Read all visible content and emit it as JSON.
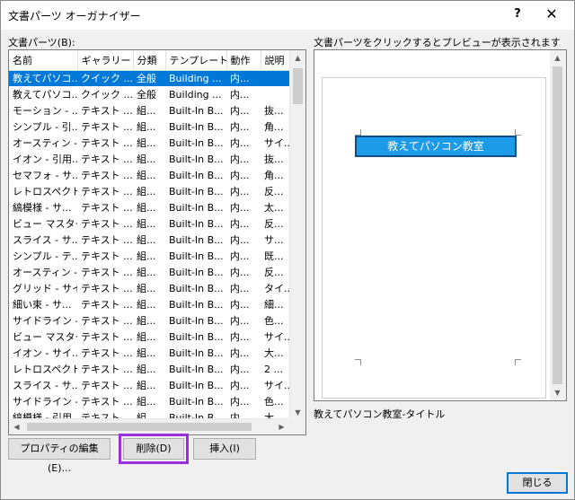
{
  "window": {
    "title": "文書パーツ オーガナイザー",
    "help_glyph": "?",
    "close_glyph": "✕"
  },
  "list": {
    "label": "文書パーツ(B):",
    "columns": [
      "名前",
      "ギャラリー",
      "分類",
      "テンプレート",
      "動作",
      "説明"
    ],
    "rows": [
      [
        "教えてパソコ...",
        "クイック ...",
        "全般",
        "Building ...",
        "内...",
        ""
      ],
      [
        "教えてパソコ...",
        "クイック ...",
        "全般",
        "Building ...",
        "内...",
        ""
      ],
      [
        "モーション - ...",
        "テキスト ...",
        "組...",
        "Built-In B...",
        "内...",
        "抜..."
      ],
      [
        "シンプル - 引...",
        "テキスト ...",
        "組...",
        "Built-In B...",
        "内...",
        "角..."
      ],
      [
        "オースティン - ...",
        "テキスト ...",
        "組...",
        "Built-In B...",
        "内...",
        "サイ..."
      ],
      [
        "イオン - 引用...",
        "テキスト ...",
        "組...",
        "Built-In B...",
        "内...",
        "抜..."
      ],
      [
        "セマフォ - サ...",
        "テキスト ...",
        "組...",
        "Built-In B...",
        "内...",
        "角..."
      ],
      [
        "レトロスペクト...",
        "テキスト ...",
        "組...",
        "Built-In B...",
        "内...",
        "反..."
      ],
      [
        "縞模様 - サ...",
        "テキスト ...",
        "組...",
        "Built-In B...",
        "内...",
        "太..."
      ],
      [
        "ビュー マスター...",
        "テキスト ...",
        "組...",
        "Built-In B...",
        "内...",
        "反..."
      ],
      [
        "スライス - サ...",
        "テキスト ...",
        "組...",
        "Built-In B...",
        "内...",
        "サ..."
      ],
      [
        "シンプル - テ...",
        "テキスト ...",
        "組...",
        "Built-In B...",
        "内...",
        "既..."
      ],
      [
        "オースティン - ...",
        "テキスト ...",
        "組...",
        "Built-In B...",
        "内...",
        "反..."
      ],
      [
        "グリッド - サイ...",
        "テキスト ...",
        "組...",
        "Built-In B...",
        "内...",
        "タイ..."
      ],
      [
        "細い束 - サ...",
        "テキスト ...",
        "組...",
        "Built-In B...",
        "内...",
        "細..."
      ],
      [
        "サイドライン - ...",
        "テキスト ...",
        "組...",
        "Built-In B...",
        "内...",
        "色..."
      ],
      [
        "ビュー マスター...",
        "テキスト ...",
        "組...",
        "Built-In B...",
        "内...",
        "サイ..."
      ],
      [
        "イオン - サイ...",
        "テキスト ...",
        "組...",
        "Built-In B...",
        "内...",
        "大..."
      ],
      [
        "レトロスペクト...",
        "テキスト ...",
        "組...",
        "Built-In B...",
        "内...",
        "2 ..."
      ],
      [
        "スライス - サ...",
        "テキスト ...",
        "組...",
        "Built-In B...",
        "内...",
        "サイ..."
      ],
      [
        "サイドライン - ...",
        "テキスト ...",
        "組...",
        "Built-In B...",
        "内...",
        "色..."
      ],
      [
        "縞模様 - 引用...",
        "テキスト ...",
        "組...",
        "Built-In B...",
        "内...",
        "大..."
      ]
    ]
  },
  "preview": {
    "label": "文書パーツをクリックするとプレビューが表示されます",
    "block_text": "教えてパソコン教室",
    "caption": "教えてパソコン教室-タイトル"
  },
  "buttons": {
    "properties": "プロパティの編集(E)...",
    "delete": "削除(D)",
    "insert": "挿入(I)",
    "close": "閉じる"
  },
  "colors": {
    "selection": "#0078d7",
    "highlight_outline": "#9b30d9",
    "title_block_fill": "#1b9be8"
  }
}
